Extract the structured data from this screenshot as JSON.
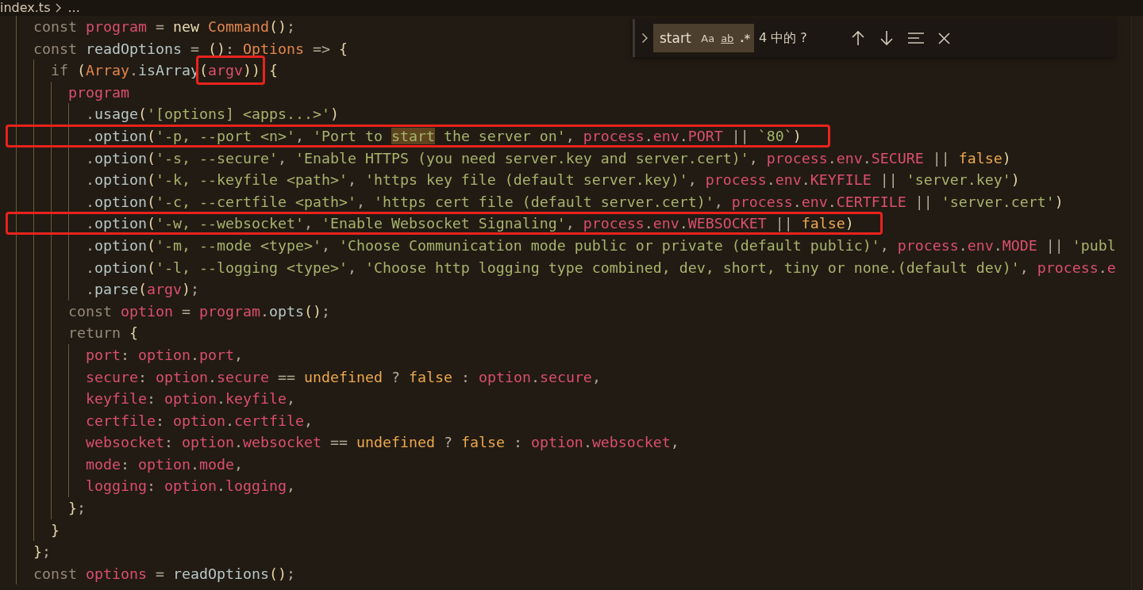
{
  "breadcrumb": {
    "file": "index.ts",
    "more": "..."
  },
  "find_widget": {
    "query": "start",
    "options": [
      {
        "label": "Aa",
        "kind": "case",
        "selected": false
      },
      {
        "label": "ab",
        "kind": "word",
        "selected": false
      },
      {
        "label": ".*",
        "kind": "regex",
        "selected": false
      }
    ],
    "result": "4 中的 ?"
  },
  "lines": [
    {
      "boxed": false,
      "tokens": [
        {
          "kind": "kw",
          "t": "  const "
        },
        {
          "kind": "var",
          "t": "program"
        },
        {
          "kind": "o",
          "t": " = "
        },
        {
          "kind": "kw2",
          "t": "new "
        },
        {
          "kind": "type",
          "t": "Command"
        },
        {
          "kind": "p",
          "t": "()"
        },
        {
          "kind": "o",
          "t": ";"
        }
      ]
    },
    {
      "boxed": false,
      "tokens": [
        {
          "kind": "kw",
          "t": "  const "
        },
        {
          "kind": "fn",
          "t": "readOptions"
        },
        {
          "kind": "o",
          "t": " = "
        },
        {
          "kind": "p",
          "t": "()"
        },
        {
          "kind": "o",
          "t": ": "
        },
        {
          "kind": "type",
          "t": "Options"
        },
        {
          "kind": "o",
          "t": " => "
        },
        {
          "kind": "p",
          "t": "{"
        }
      ]
    },
    {
      "boxed": false,
      "tokens": [
        {
          "kind": "kw",
          "t": "    if "
        },
        {
          "kind": "p",
          "t": "("
        },
        {
          "kind": "type",
          "t": "Array"
        },
        {
          "kind": "o",
          "t": "."
        },
        {
          "kind": "fn",
          "t": "isArray"
        },
        {
          "kind": "p",
          "t": "(",
          "boxed": true
        },
        {
          "kind": "var",
          "t": "argv",
          "boxed": true
        },
        {
          "kind": "p",
          "t": "))",
          "boxed": true
        },
        {
          "kind": "p",
          "t": " {"
        }
      ]
    },
    {
      "boxed": false,
      "tokens": [
        {
          "kind": "var",
          "t": "      program"
        }
      ]
    },
    {
      "boxed": false,
      "tokens": [
        {
          "kind": "o",
          "t": "        ."
        },
        {
          "kind": "fn",
          "t": "usage"
        },
        {
          "kind": "p",
          "t": "("
        },
        {
          "kind": "str",
          "t": "'[options] <apps...>'"
        },
        {
          "kind": "p",
          "t": ")"
        }
      ]
    },
    {
      "boxed": true,
      "tokens": [
        {
          "kind": "o",
          "t": "        ."
        },
        {
          "kind": "fn",
          "t": "option"
        },
        {
          "kind": "p",
          "t": "("
        },
        {
          "kind": "str",
          "t": "'-p, --port <n>'"
        },
        {
          "kind": "o",
          "t": ", "
        },
        {
          "kind": "str",
          "t": "'Port to "
        },
        {
          "kind": "str",
          "t": "start",
          "match": true
        },
        {
          "kind": "str",
          "t": " the server on'"
        },
        {
          "kind": "o",
          "t": ", "
        },
        {
          "kind": "var",
          "t": "process"
        },
        {
          "kind": "o",
          "t": "."
        },
        {
          "kind": "var",
          "t": "env"
        },
        {
          "kind": "o",
          "t": "."
        },
        {
          "kind": "var",
          "t": "PORT"
        },
        {
          "kind": "o",
          "t": " || "
        },
        {
          "kind": "str",
          "t": "`80`"
        },
        {
          "kind": "p",
          "t": ")"
        }
      ]
    },
    {
      "boxed": false,
      "tokens": [
        {
          "kind": "o",
          "t": "        ."
        },
        {
          "kind": "fn",
          "t": "option"
        },
        {
          "kind": "p",
          "t": "("
        },
        {
          "kind": "str",
          "t": "'-s, --secure'"
        },
        {
          "kind": "o",
          "t": ", "
        },
        {
          "kind": "str",
          "t": "'Enable HTTPS (you need server.key and server.cert)'"
        },
        {
          "kind": "o",
          "t": ", "
        },
        {
          "kind": "var",
          "t": "process"
        },
        {
          "kind": "o",
          "t": "."
        },
        {
          "kind": "var",
          "t": "env"
        },
        {
          "kind": "o",
          "t": "."
        },
        {
          "kind": "var",
          "t": "SECURE"
        },
        {
          "kind": "o",
          "t": " || "
        },
        {
          "kind": "lit",
          "t": "false"
        },
        {
          "kind": "p",
          "t": ")"
        }
      ]
    },
    {
      "boxed": false,
      "tokens": [
        {
          "kind": "o",
          "t": "        ."
        },
        {
          "kind": "fn",
          "t": "option"
        },
        {
          "kind": "p",
          "t": "("
        },
        {
          "kind": "str",
          "t": "'-k, --keyfile <path>'"
        },
        {
          "kind": "o",
          "t": ", "
        },
        {
          "kind": "str",
          "t": "'https key file (default server.key)'"
        },
        {
          "kind": "o",
          "t": ", "
        },
        {
          "kind": "var",
          "t": "process"
        },
        {
          "kind": "o",
          "t": "."
        },
        {
          "kind": "var",
          "t": "env"
        },
        {
          "kind": "o",
          "t": "."
        },
        {
          "kind": "var",
          "t": "KEYFILE"
        },
        {
          "kind": "o",
          "t": " || "
        },
        {
          "kind": "str",
          "t": "'server.key'"
        },
        {
          "kind": "p",
          "t": ")"
        }
      ]
    },
    {
      "boxed": false,
      "tokens": [
        {
          "kind": "o",
          "t": "        ."
        },
        {
          "kind": "fn",
          "t": "option"
        },
        {
          "kind": "p",
          "t": "("
        },
        {
          "kind": "str",
          "t": "'-c, --certfile <path>'"
        },
        {
          "kind": "o",
          "t": ", "
        },
        {
          "kind": "str",
          "t": "'https cert file (default server.cert)'"
        },
        {
          "kind": "o",
          "t": ", "
        },
        {
          "kind": "var",
          "t": "process"
        },
        {
          "kind": "o",
          "t": "."
        },
        {
          "kind": "var",
          "t": "env"
        },
        {
          "kind": "o",
          "t": "."
        },
        {
          "kind": "var",
          "t": "CERTFILE"
        },
        {
          "kind": "o",
          "t": " || "
        },
        {
          "kind": "str",
          "t": "'server.cert'"
        },
        {
          "kind": "p",
          "t": ")"
        }
      ]
    },
    {
      "boxed": true,
      "tokens": [
        {
          "kind": "o",
          "t": "        ."
        },
        {
          "kind": "fn",
          "t": "option"
        },
        {
          "kind": "p",
          "t": "("
        },
        {
          "kind": "str",
          "t": "'-w, --websocket'"
        },
        {
          "kind": "o",
          "t": ", "
        },
        {
          "kind": "str",
          "t": "'Enable Websocket Signaling'"
        },
        {
          "kind": "o",
          "t": ", "
        },
        {
          "kind": "var",
          "t": "process"
        },
        {
          "kind": "o",
          "t": "."
        },
        {
          "kind": "var",
          "t": "env"
        },
        {
          "kind": "o",
          "t": "."
        },
        {
          "kind": "var",
          "t": "WEBSOCKET"
        },
        {
          "kind": "o",
          "t": " || "
        },
        {
          "kind": "lit",
          "t": "false"
        },
        {
          "kind": "p",
          "t": ")"
        }
      ]
    },
    {
      "boxed": false,
      "tokens": [
        {
          "kind": "o",
          "t": "        ."
        },
        {
          "kind": "fn",
          "t": "option"
        },
        {
          "kind": "p",
          "t": "("
        },
        {
          "kind": "str",
          "t": "'-m, --mode <type>'"
        },
        {
          "kind": "o",
          "t": ", "
        },
        {
          "kind": "str",
          "t": "'Choose Communication mode public or private (default public)'"
        },
        {
          "kind": "o",
          "t": ", "
        },
        {
          "kind": "var",
          "t": "process"
        },
        {
          "kind": "o",
          "t": "."
        },
        {
          "kind": "var",
          "t": "env"
        },
        {
          "kind": "o",
          "t": "."
        },
        {
          "kind": "var",
          "t": "MODE"
        },
        {
          "kind": "o",
          "t": " || "
        },
        {
          "kind": "str",
          "t": "'publ"
        }
      ]
    },
    {
      "boxed": false,
      "tokens": [
        {
          "kind": "o",
          "t": "        ."
        },
        {
          "kind": "fn",
          "t": "option"
        },
        {
          "kind": "p",
          "t": "("
        },
        {
          "kind": "str",
          "t": "'-l, --logging <type>'"
        },
        {
          "kind": "o",
          "t": ", "
        },
        {
          "kind": "str",
          "t": "'Choose http logging type combined, dev, short, tiny or none.(default dev)'"
        },
        {
          "kind": "o",
          "t": ", "
        },
        {
          "kind": "var",
          "t": "process"
        },
        {
          "kind": "o",
          "t": "."
        },
        {
          "kind": "var",
          "t": "e"
        }
      ]
    },
    {
      "boxed": false,
      "tokens": [
        {
          "kind": "o",
          "t": "        ."
        },
        {
          "kind": "fn",
          "t": "parse"
        },
        {
          "kind": "p",
          "t": "("
        },
        {
          "kind": "var",
          "t": "argv"
        },
        {
          "kind": "p",
          "t": ")"
        },
        {
          "kind": "o",
          "t": ";"
        }
      ]
    },
    {
      "boxed": false,
      "tokens": [
        {
          "kind": "kw",
          "t": "      const "
        },
        {
          "kind": "var",
          "t": "option"
        },
        {
          "kind": "o",
          "t": " = "
        },
        {
          "kind": "var",
          "t": "program"
        },
        {
          "kind": "o",
          "t": "."
        },
        {
          "kind": "fn",
          "t": "opts"
        },
        {
          "kind": "p",
          "t": "()"
        },
        {
          "kind": "o",
          "t": ";"
        }
      ]
    },
    {
      "boxed": false,
      "tokens": [
        {
          "kind": "kw",
          "t": "      return "
        },
        {
          "kind": "p",
          "t": "{"
        }
      ]
    },
    {
      "boxed": false,
      "tokens": [
        {
          "kind": "var",
          "t": "        port"
        },
        {
          "kind": "o",
          "t": ": "
        },
        {
          "kind": "var",
          "t": "option"
        },
        {
          "kind": "o",
          "t": "."
        },
        {
          "kind": "var",
          "t": "port"
        },
        {
          "kind": "o",
          "t": ","
        }
      ]
    },
    {
      "boxed": false,
      "tokens": [
        {
          "kind": "var",
          "t": "        secure"
        },
        {
          "kind": "o",
          "t": ": "
        },
        {
          "kind": "var",
          "t": "option"
        },
        {
          "kind": "o",
          "t": "."
        },
        {
          "kind": "var",
          "t": "secure"
        },
        {
          "kind": "o",
          "t": " == "
        },
        {
          "kind": "lit",
          "t": "undefined"
        },
        {
          "kind": "o",
          "t": " ? "
        },
        {
          "kind": "lit",
          "t": "false"
        },
        {
          "kind": "o",
          "t": " : "
        },
        {
          "kind": "var",
          "t": "option"
        },
        {
          "kind": "o",
          "t": "."
        },
        {
          "kind": "var",
          "t": "secure"
        },
        {
          "kind": "o",
          "t": ","
        }
      ]
    },
    {
      "boxed": false,
      "tokens": [
        {
          "kind": "var",
          "t": "        keyfile"
        },
        {
          "kind": "o",
          "t": ": "
        },
        {
          "kind": "var",
          "t": "option"
        },
        {
          "kind": "o",
          "t": "."
        },
        {
          "kind": "var",
          "t": "keyfile"
        },
        {
          "kind": "o",
          "t": ","
        }
      ]
    },
    {
      "boxed": false,
      "tokens": [
        {
          "kind": "var",
          "t": "        certfile"
        },
        {
          "kind": "o",
          "t": ": "
        },
        {
          "kind": "var",
          "t": "option"
        },
        {
          "kind": "o",
          "t": "."
        },
        {
          "kind": "var",
          "t": "certfile"
        },
        {
          "kind": "o",
          "t": ","
        }
      ]
    },
    {
      "boxed": false,
      "tokens": [
        {
          "kind": "var",
          "t": "        websocket"
        },
        {
          "kind": "o",
          "t": ": "
        },
        {
          "kind": "var",
          "t": "option"
        },
        {
          "kind": "o",
          "t": "."
        },
        {
          "kind": "var",
          "t": "websocket"
        },
        {
          "kind": "o",
          "t": " == "
        },
        {
          "kind": "lit",
          "t": "undefined"
        },
        {
          "kind": "o",
          "t": " ? "
        },
        {
          "kind": "lit",
          "t": "false"
        },
        {
          "kind": "o",
          "t": " : "
        },
        {
          "kind": "var",
          "t": "option"
        },
        {
          "kind": "o",
          "t": "."
        },
        {
          "kind": "var",
          "t": "websocket"
        },
        {
          "kind": "o",
          "t": ","
        }
      ]
    },
    {
      "boxed": false,
      "tokens": [
        {
          "kind": "var",
          "t": "        mode"
        },
        {
          "kind": "o",
          "t": ": "
        },
        {
          "kind": "var",
          "t": "option"
        },
        {
          "kind": "o",
          "t": "."
        },
        {
          "kind": "var",
          "t": "mode"
        },
        {
          "kind": "o",
          "t": ","
        }
      ]
    },
    {
      "boxed": false,
      "tokens": [
        {
          "kind": "var",
          "t": "        logging"
        },
        {
          "kind": "o",
          "t": ": "
        },
        {
          "kind": "var",
          "t": "option"
        },
        {
          "kind": "o",
          "t": "."
        },
        {
          "kind": "var",
          "t": "logging"
        },
        {
          "kind": "o",
          "t": ","
        }
      ]
    },
    {
      "boxed": false,
      "tokens": [
        {
          "kind": "p",
          "t": "      }"
        },
        {
          "kind": "o",
          "t": ";"
        }
      ]
    },
    {
      "boxed": false,
      "tokens": [
        {
          "kind": "p",
          "t": "    }"
        }
      ]
    },
    {
      "boxed": false,
      "tokens": [
        {
          "kind": "p",
          "t": "  }"
        },
        {
          "kind": "o",
          "t": ";"
        }
      ]
    },
    {
      "boxed": false,
      "tokens": [
        {
          "kind": "kw",
          "t": "  const "
        },
        {
          "kind": "var",
          "t": "options"
        },
        {
          "kind": "o",
          "t": " = "
        },
        {
          "kind": "fn",
          "t": "readOptions"
        },
        {
          "kind": "p",
          "t": "()"
        },
        {
          "kind": "o",
          "t": ";"
        }
      ]
    }
  ]
}
